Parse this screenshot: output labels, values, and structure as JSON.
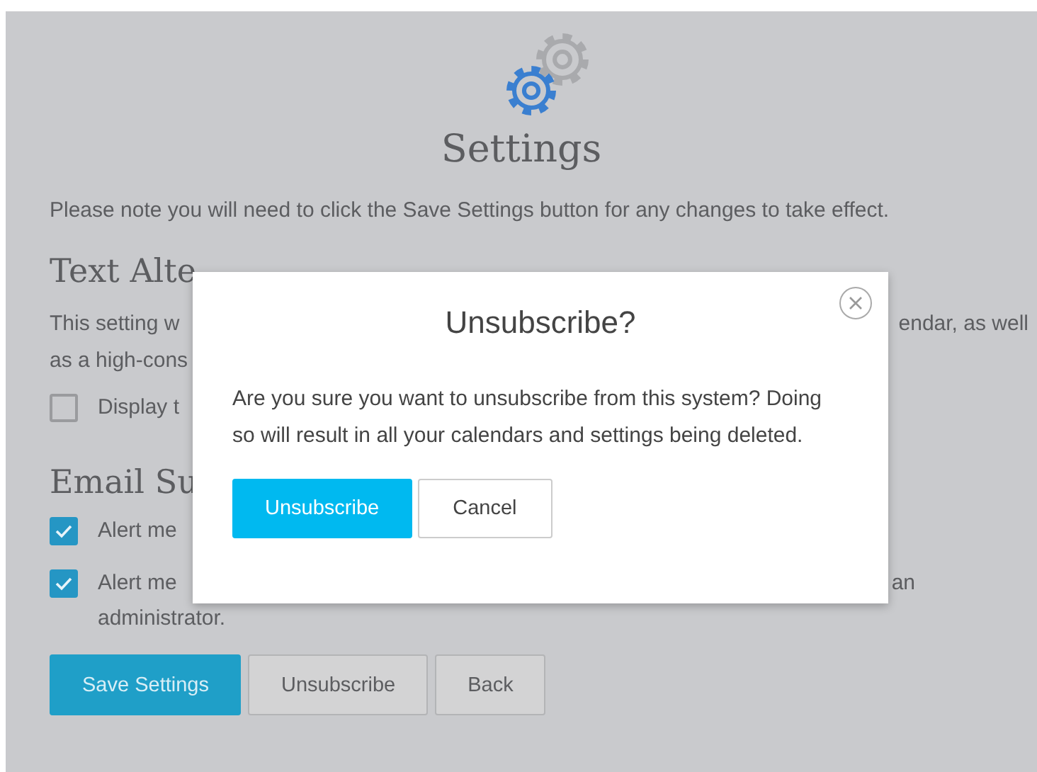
{
  "page": {
    "title": "Settings",
    "note": "Please note you will need to click the Save Settings button for any changes to take effect.",
    "sections": [
      {
        "heading": "Text Alte",
        "text_lines": [
          {
            "left": "This setting w",
            "right": "endar, as well"
          },
          {
            "left": "as a high-cons"
          }
        ],
        "options": [
          {
            "kind": "checkbox",
            "checked": false,
            "lines": [
              {
                "left": "Display t"
              }
            ]
          }
        ]
      },
      {
        "heading": "Email Su",
        "options": [
          {
            "kind": "checkbox",
            "checked": true,
            "lines": [
              {
                "left": "Alert me"
              }
            ]
          },
          {
            "kind": "checkbox",
            "checked": true,
            "lines": [
              {
                "left": "Alert me",
                "right": "an"
              },
              {
                "left": "administrator."
              }
            ]
          }
        ]
      }
    ],
    "buttons": [
      {
        "label": "Save Settings",
        "kind": "primary"
      },
      {
        "label": "Unsubscribe",
        "kind": "secondary"
      },
      {
        "label": "Back",
        "kind": "secondary"
      }
    ]
  },
  "dialog": {
    "title": "Unsubscribe?",
    "message": "Are you sure you want to unsubscribe from this system? Doing so will result in all your calendars and settings being deleted.",
    "buttons": [
      {
        "label": "Unsubscribe",
        "kind": "primary"
      },
      {
        "label": "Cancel",
        "kind": "secondary"
      }
    ]
  }
}
